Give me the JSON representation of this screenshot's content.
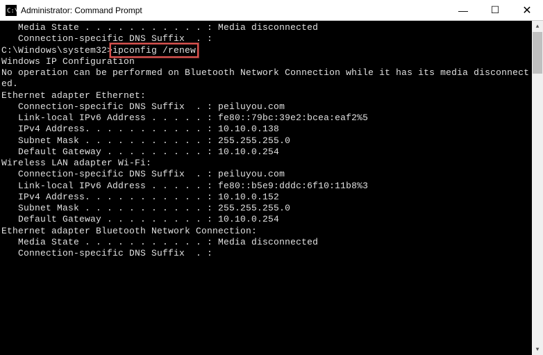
{
  "titlebar": {
    "title": "Administrator: Command Prompt"
  },
  "window_controls": {
    "minimize": "—",
    "maximize": "☐",
    "close": "✕"
  },
  "terminal": {
    "lines": [
      "   Media State . . . . . . . . . . . : Media disconnected",
      "   Connection-specific DNS Suffix  . :",
      "",
      "C:\\Windows\\system32>ipconfig /renew",
      "",
      "Windows IP Configuration",
      "",
      "No operation can be performed on Bluetooth Network Connection while it has its media disconnect",
      "ed.",
      "",
      "Ethernet adapter Ethernet:",
      "",
      "   Connection-specific DNS Suffix  . : peiluyou.com",
      "   Link-local IPv6 Address . . . . . : fe80::79bc:39e2:bcea:eaf2%5",
      "   IPv4 Address. . . . . . . . . . . : 10.10.0.138",
      "   Subnet Mask . . . . . . . . . . . : 255.255.255.0",
      "   Default Gateway . . . . . . . . . : 10.10.0.254",
      "",
      "Wireless LAN adapter Wi-Fi:",
      "",
      "   Connection-specific DNS Suffix  . : peiluyou.com",
      "   Link-local IPv6 Address . . . . . : fe80::b5e9:dddc:6f10:11b8%3",
      "   IPv4 Address. . . . . . . . . . . : 10.10.0.152",
      "   Subnet Mask . . . . . . . . . . . : 255.255.255.0",
      "   Default Gateway . . . . . . . . . : 10.10.0.254",
      "",
      "Ethernet adapter Bluetooth Network Connection:",
      "",
      "   Media State . . . . . . . . . . . : Media disconnected",
      "   Connection-specific DNS Suffix  . :"
    ],
    "highlighted_command": "ipconfig /renew"
  },
  "scrollbar": {
    "up": "▲",
    "down": "▼"
  }
}
